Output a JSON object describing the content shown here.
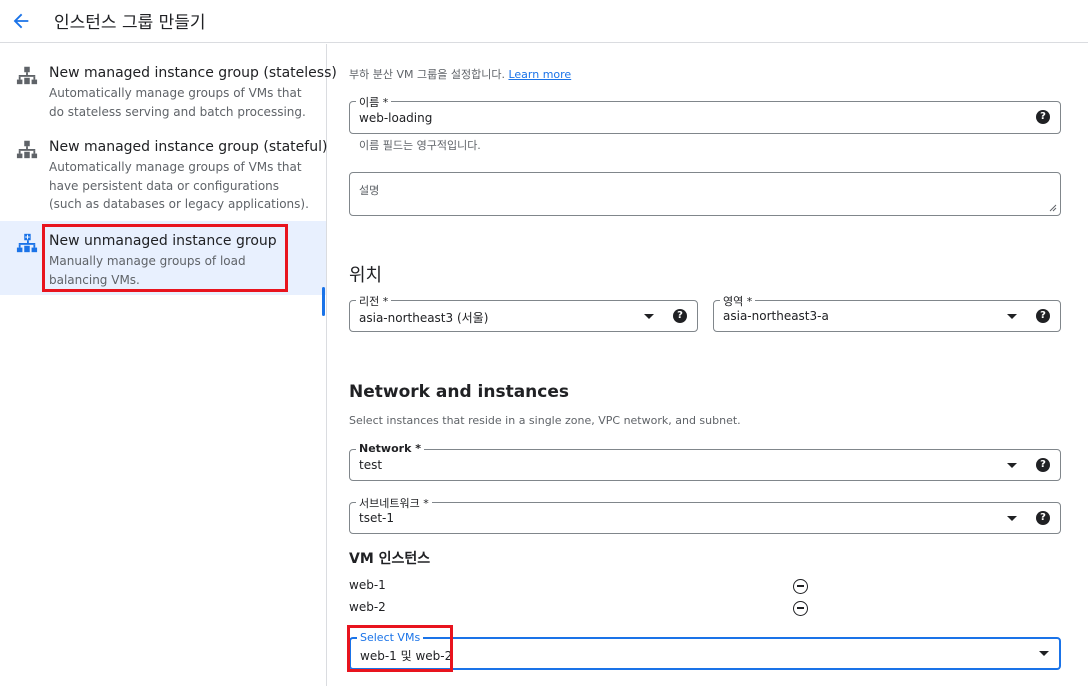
{
  "header": {
    "title": "인스턴스 그룹 만들기",
    "back_icon": "arrow-back-icon"
  },
  "sidebar": {
    "items": [
      {
        "title": "New managed instance group (stateless)",
        "description": "Automatically manage groups of VMs that do stateless serving and batch processing."
      },
      {
        "title": "New managed instance group (stateful)",
        "description": "Automatically manage groups of VMs that have persistent data or configurations (such as databases or legacy applications)."
      },
      {
        "title": "New unmanaged instance group",
        "description": "Manually manage groups of load balancing VMs.",
        "selected": true
      }
    ]
  },
  "main": {
    "intro": "부하 분산 VM 그룹을 설정합니다.",
    "learn_more": "Learn more",
    "name_field": {
      "label": "이름 *",
      "value": "web-loading",
      "hint": "이름 필드는 영구적입니다."
    },
    "description_field": {
      "placeholder": "설명"
    },
    "location": {
      "heading": "위치",
      "region": {
        "label": "리전 *",
        "value": "asia-northeast3 (서울)"
      },
      "zone": {
        "label": "영역 *",
        "value": "asia-northeast3-a"
      }
    },
    "network": {
      "heading": "Network and instances",
      "description": "Select instances that reside in a single zone, VPC network, and subnet.",
      "network_field": {
        "label": "Network *",
        "value": "test"
      },
      "subnet_field": {
        "label": "서브네트워크 *",
        "value": "tset-1"
      }
    },
    "vm_instances": {
      "heading": "VM 인스턴스",
      "items": [
        "web-1",
        "web-2"
      ],
      "select": {
        "label": "Select VMs",
        "value": "web-1 및 web-2"
      }
    }
  },
  "colors": {
    "accent": "#1a73e8",
    "highlight_box": "#e8141e",
    "selected_bg": "#e8f0fe"
  }
}
